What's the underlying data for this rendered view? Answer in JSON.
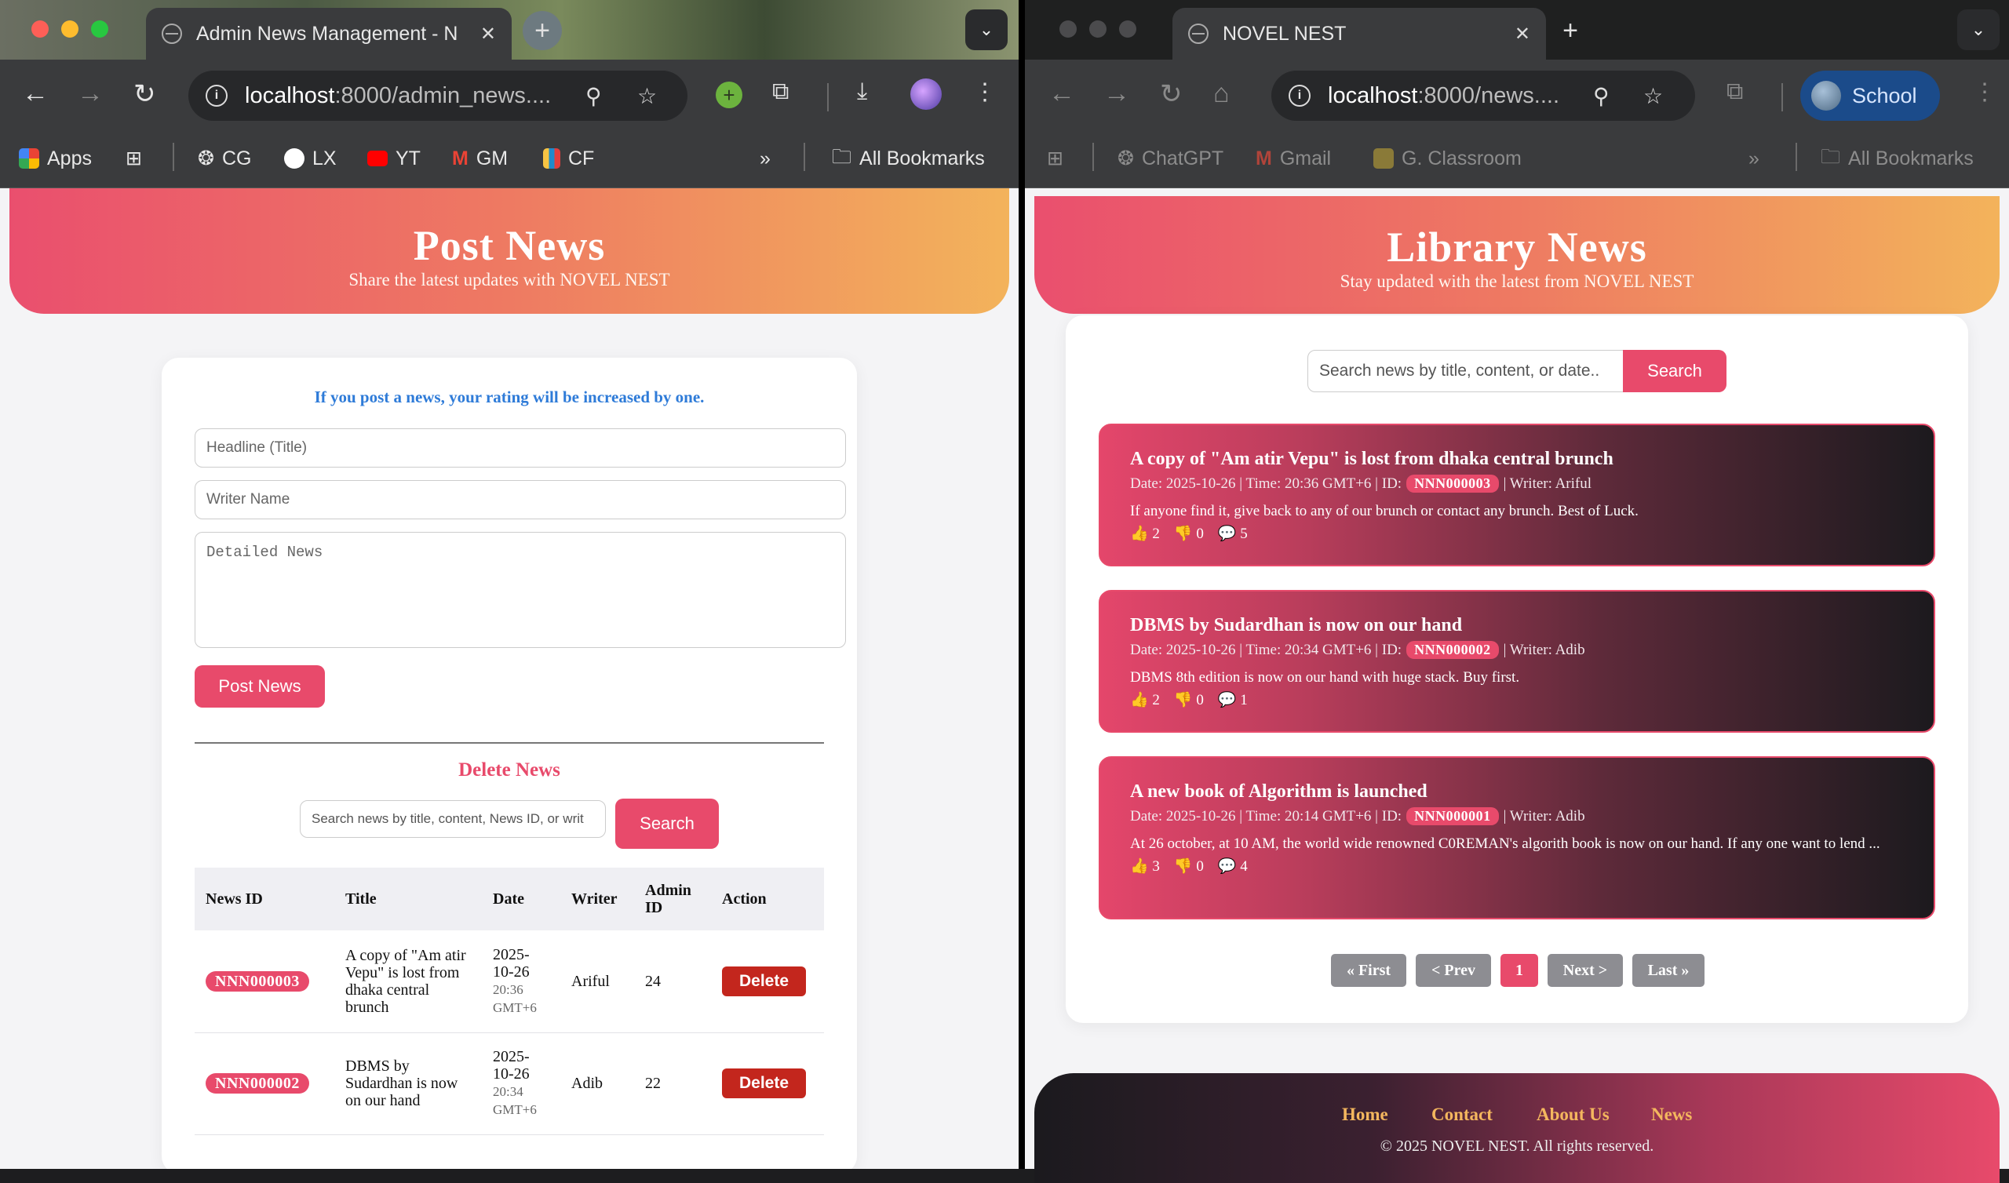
{
  "left_window": {
    "tab_title": "Admin News Management - N",
    "url_host": "localhost",
    "url_path": ":8000/admin_news....",
    "bookmarks": [
      {
        "label": "Apps",
        "icon": "apps-grid-icon"
      },
      {
        "label": "CG",
        "icon": "chatgpt-icon"
      },
      {
        "label": "LX",
        "icon": "lx-icon"
      },
      {
        "label": "YT",
        "icon": "youtube-icon"
      },
      {
        "label": "GM",
        "icon": "gmail-icon"
      },
      {
        "label": "CF",
        "icon": "codeforces-icon"
      }
    ],
    "all_bookmarks": "All Bookmarks"
  },
  "right_window": {
    "tab_title": "NOVEL NEST",
    "url_host": "localhost",
    "url_path": ":8000/news....",
    "profile": "School",
    "bookmarks": [
      {
        "label": "ChatGPT",
        "icon": "chatgpt-icon"
      },
      {
        "label": "Gmail",
        "icon": "gmail-icon"
      },
      {
        "label": "G. Classroom",
        "icon": "classroom-icon"
      }
    ],
    "all_bookmarks": "All Bookmarks"
  },
  "admin": {
    "title": "Post News",
    "subtitle": "Share the latest updates with NOVEL NEST",
    "note": "If you post a news, your rating will be increased by one.",
    "headline_placeholder": "Headline (Title)",
    "writer_placeholder": "Writer Name",
    "detail_placeholder": "Detailed News",
    "post_button": "Post News",
    "delete_title": "Delete News",
    "search_placeholder": "Search news by title, content, News ID, or writ",
    "search_button": "Search",
    "columns": [
      "News ID",
      "Title",
      "Date",
      "Writer",
      "Admin ID",
      "Action"
    ],
    "rows": [
      {
        "id": "NNN000003",
        "title": "A copy of \"Am atir Vepu\" is lost from dhaka central brunch",
        "date": "2025-10-26",
        "time": "20:36 GMT+6",
        "writer": "Ariful",
        "admin_id": "24",
        "action": "Delete"
      },
      {
        "id": "NNN000002",
        "title": "DBMS by Sudardhan is now on our hand",
        "date": "2025-10-26",
        "time": "20:34 GMT+6",
        "writer": "Adib",
        "admin_id": "22",
        "action": "Delete"
      }
    ]
  },
  "library": {
    "title": "Library News",
    "subtitle": "Stay updated with the latest from NOVEL NEST",
    "search_placeholder": "Search news by title, content, or date..",
    "search_button": "Search",
    "news": [
      {
        "title": "A copy of \"Am atir Vepu\" is lost from dhaka central brunch",
        "meta_pre": "Date: 2025-10-26 | Time: 20:36 GMT+6 | ID:",
        "id": "NNN000003",
        "meta_post": "| Writer: Ariful",
        "body": "If anyone find it, give back to any of our brunch or contact any brunch. Best of Luck.",
        "likes": "2",
        "dislikes": "0",
        "comments": "5"
      },
      {
        "title": "DBMS by Sudardhan is now on our hand",
        "meta_pre": "Date: 2025-10-26 | Time: 20:34 GMT+6 | ID:",
        "id": "NNN000002",
        "meta_post": "| Writer: Adib",
        "body": "DBMS 8th edition is now on our hand with huge stack. Buy first.",
        "likes": "2",
        "dislikes": "0",
        "comments": "1"
      },
      {
        "title": "A new book of Algorithm is launched",
        "meta_pre": "Date: 2025-10-26 | Time: 20:14 GMT+6 | ID:",
        "id": "NNN000001",
        "meta_post": "| Writer: Adib",
        "body": "At 26 october, at 10 AM, the world wide renowned C0REMAN's algorith book is now on our hand. If any one want to lend ...",
        "likes": "3",
        "dislikes": "0",
        "comments": "4"
      }
    ],
    "pagination": [
      "« First",
      "< Prev",
      "1",
      "Next >",
      "Last »"
    ],
    "footer_links": [
      "Home",
      "Contact",
      "About Us",
      "News"
    ],
    "copyright": "© 2025 NOVEL NEST. All rights reserved."
  },
  "colors": {
    "accent": "#e84a6b",
    "delete": "#c3261d",
    "note_blue": "#2e7bd8",
    "footer_link": "#f4b75e"
  }
}
